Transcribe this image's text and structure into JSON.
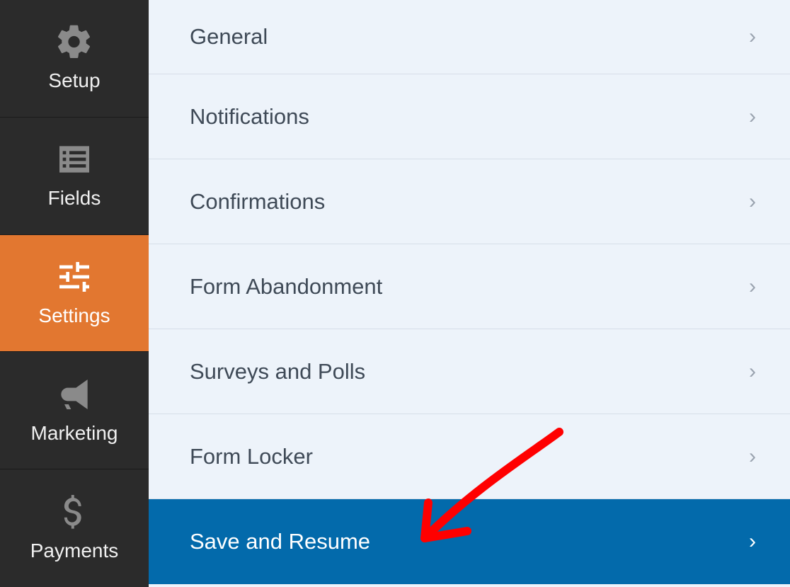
{
  "sidebar": {
    "items": [
      {
        "label": "Setup",
        "icon": "gear"
      },
      {
        "label": "Fields",
        "icon": "list"
      },
      {
        "label": "Settings",
        "icon": "sliders",
        "active": true
      },
      {
        "label": "Marketing",
        "icon": "megaphone"
      },
      {
        "label": "Payments",
        "icon": "dollar"
      }
    ]
  },
  "settings": {
    "items": [
      {
        "label": "General"
      },
      {
        "label": "Notifications"
      },
      {
        "label": "Confirmations"
      },
      {
        "label": "Form Abandonment"
      },
      {
        "label": "Surveys and Polls"
      },
      {
        "label": "Form Locker"
      },
      {
        "label": "Save and Resume",
        "selected": true
      }
    ]
  },
  "colors": {
    "sidebar_bg": "#2b2b2b",
    "sidebar_active": "#e27730",
    "selected_row": "#036aab",
    "main_bg": "#edf3fa",
    "annotation": "#ff0000"
  }
}
